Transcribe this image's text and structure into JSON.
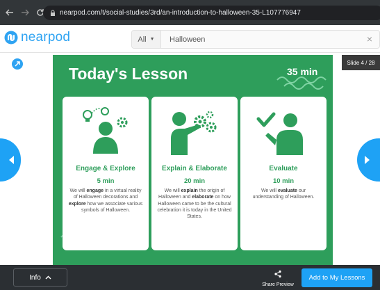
{
  "browser": {
    "url": "nearpod.com/t/social-studies/3rd/an-introduction-to-halloween-35-L107776947"
  },
  "header": {
    "logo_text": "nearpod",
    "search": {
      "category": "All",
      "query": "Halloween"
    }
  },
  "viewer": {
    "slide_counter": "Slide 4 / 28"
  },
  "slide": {
    "title": "Today's Lesson",
    "total_time": "35 min",
    "cards": [
      {
        "title": "Engage & Explore",
        "duration": "5 min",
        "desc_parts": [
          "We will ",
          "engage",
          " in a virtual reality of Halloween decorations and ",
          "explore",
          " how we associate various symbols of Halloween."
        ]
      },
      {
        "title": "Explain & Elaborate",
        "duration": "20 min",
        "desc_parts": [
          "We will ",
          "explain",
          " the origin of Halloween and ",
          "elaborate",
          " on how Halloween came to be the cultural celebration it is today in the United States."
        ]
      },
      {
        "title": "Evaluate",
        "duration": "10 min",
        "desc_parts": [
          "We will ",
          "evaluate",
          " our understanding of Halloween.",
          "",
          ""
        ]
      }
    ]
  },
  "footer": {
    "info_label": "Info",
    "share_label": "Share Preview",
    "add_label": "Add to My Lessons"
  },
  "colors": {
    "slide_green": "#2e9e5b",
    "accent_blue": "#1ea2f5",
    "dark_bar": "#2b2f33"
  }
}
